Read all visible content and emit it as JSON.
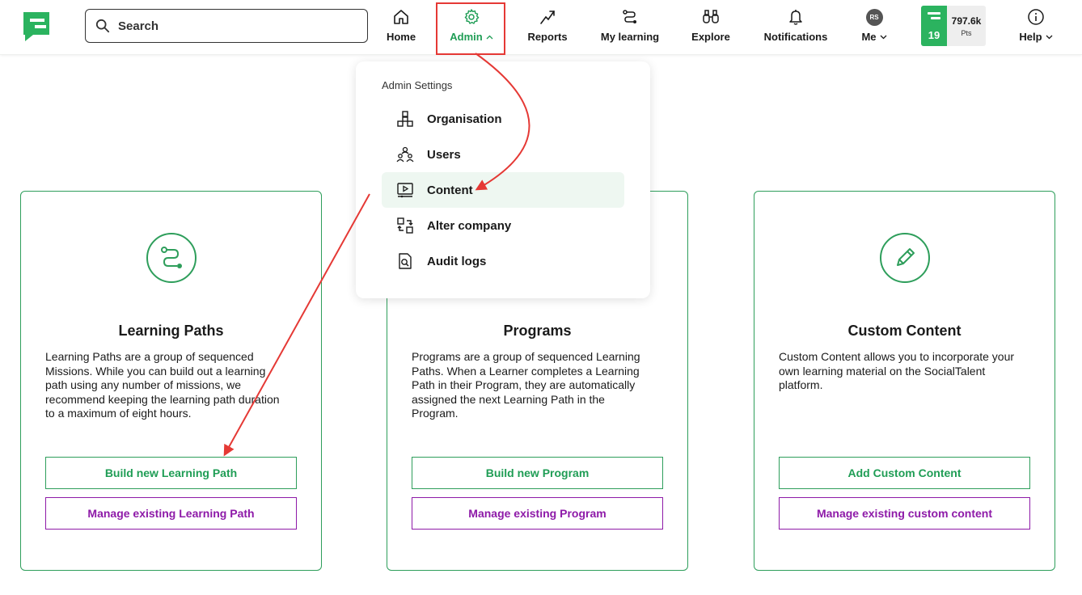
{
  "search": {
    "placeholder": "Search"
  },
  "nav": {
    "home": "Home",
    "admin": "Admin",
    "reports": "Reports",
    "my_learning": "My learning",
    "explore": "Explore",
    "notifications": "Notifications",
    "me": "Me",
    "avatar_initials": "RS",
    "help": "Help"
  },
  "points": {
    "level": "19",
    "value": "797.6k",
    "unit": "Pts"
  },
  "dropdown": {
    "heading": "Admin Settings",
    "items": [
      {
        "label": "Organisation",
        "icon": "organisation-icon"
      },
      {
        "label": "Users",
        "icon": "users-icon"
      },
      {
        "label": "Content",
        "icon": "content-icon"
      },
      {
        "label": "Alter company",
        "icon": "alter-company-icon"
      },
      {
        "label": "Audit logs",
        "icon": "audit-logs-icon"
      }
    ],
    "selected": "Content"
  },
  "cards": [
    {
      "title": "Learning Paths",
      "description": "Learning Paths are a group of sequenced Missions. While you can build out a learning path using any number of missions, we recommend keeping the learning path duration to a maximum of eight hours.",
      "primary": "Build new Learning Path",
      "secondary": "Manage existing Learning Path",
      "icon": "learning-path-icon"
    },
    {
      "title": "Programs",
      "description": "Programs are a group of sequenced Learning Paths. When a Learner completes a Learning Path in their Program, they are automatically assigned the next Learning Path in the Program.",
      "primary": "Build new Program",
      "secondary": "Manage existing Program",
      "icon": "program-icon"
    },
    {
      "title": "Custom Content",
      "description": "Custom Content allows you to incorporate your own learning material on the SocialTalent platform.",
      "primary": "Add Custom Content",
      "secondary": "Manage existing custom content",
      "icon": "pencil-icon"
    }
  ],
  "colors": {
    "brand_green": "#2e9e5b",
    "accent_purple": "#8e1aa8",
    "annotation_red": "#e53935"
  }
}
